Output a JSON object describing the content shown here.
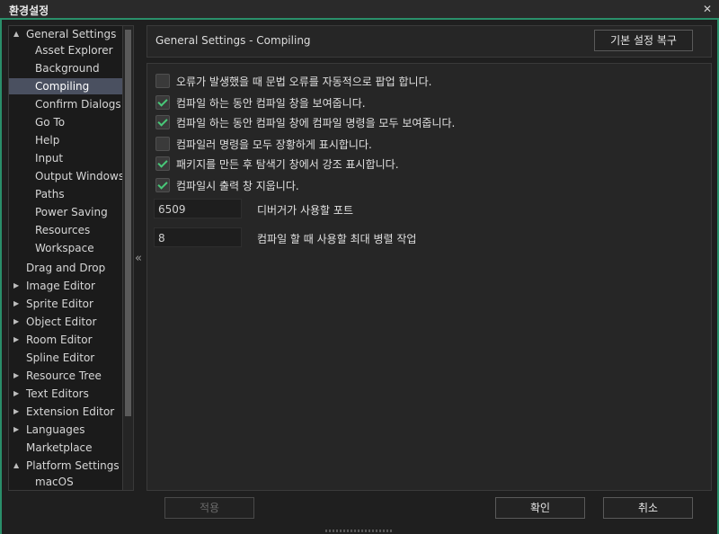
{
  "window": {
    "title": "환경설정",
    "close_glyph": "✕"
  },
  "sidebar": {
    "items": [
      {
        "label": "General Settings",
        "arrow": "▲"
      },
      {
        "label": "Asset Explorer"
      },
      {
        "label": "Background"
      },
      {
        "label": "Compiling",
        "selected": true
      },
      {
        "label": "Confirm Dialogs"
      },
      {
        "label": "Go To"
      },
      {
        "label": "Help"
      },
      {
        "label": "Input"
      },
      {
        "label": "Output Windows"
      },
      {
        "label": "Paths"
      },
      {
        "label": "Power Saving"
      },
      {
        "label": "Resources"
      },
      {
        "label": "Workspace"
      },
      {
        "label": "Drag and Drop"
      },
      {
        "label": "Image Editor",
        "arrow": "▶"
      },
      {
        "label": "Sprite Editor",
        "arrow": "▶"
      },
      {
        "label": "Object Editor",
        "arrow": "▶"
      },
      {
        "label": "Room Editor",
        "arrow": "▶"
      },
      {
        "label": "Spline Editor"
      },
      {
        "label": "Resource Tree",
        "arrow": "▶"
      },
      {
        "label": "Text Editors",
        "arrow": "▶"
      },
      {
        "label": "Extension Editor",
        "arrow": "▶"
      },
      {
        "label": "Languages",
        "arrow": "▶"
      },
      {
        "label": "Marketplace"
      },
      {
        "label": "Platform Settings",
        "arrow": "▲"
      },
      {
        "label": "macOS"
      }
    ],
    "collapse_glyph": "«"
  },
  "header": {
    "title": "General Settings - Compiling",
    "restore_defaults_label": "기본 설정 복구"
  },
  "settings": {
    "checkboxes": [
      {
        "label": "오류가 발생했을 때 문법 오류를 자동적으로 팝업 합니다.",
        "checked": false
      },
      {
        "label": "컴파일 하는 동안 컴파일 창을 보여줍니다.",
        "checked": true
      },
      {
        "label": "컴파일 하는 동안 컴파일 창에 컴파일 명령을 모두 보여줍니다.",
        "checked": true
      },
      {
        "label": "컴파일러 명령을 모두 장황하게 표시합니다.",
        "checked": false
      },
      {
        "label": "패키지를 만든 후 탐색기 창에서 강조 표시합니다.",
        "checked": true
      },
      {
        "label": "컴파일시 출력 창 지웁니다.",
        "checked": true
      }
    ],
    "debugger_port": {
      "value": "6509",
      "label": "디버거가 사용할 포트"
    },
    "max_parallel": {
      "value": "8",
      "label": "컴파일 할 때 사용할 최대 병렬 작업"
    }
  },
  "footer": {
    "apply_label": "적용",
    "ok_label": "확인",
    "cancel_label": "취소"
  },
  "colors": {
    "accent": "#2a8f6a",
    "checkmark": "#48c878",
    "selection": "#4a5060"
  }
}
